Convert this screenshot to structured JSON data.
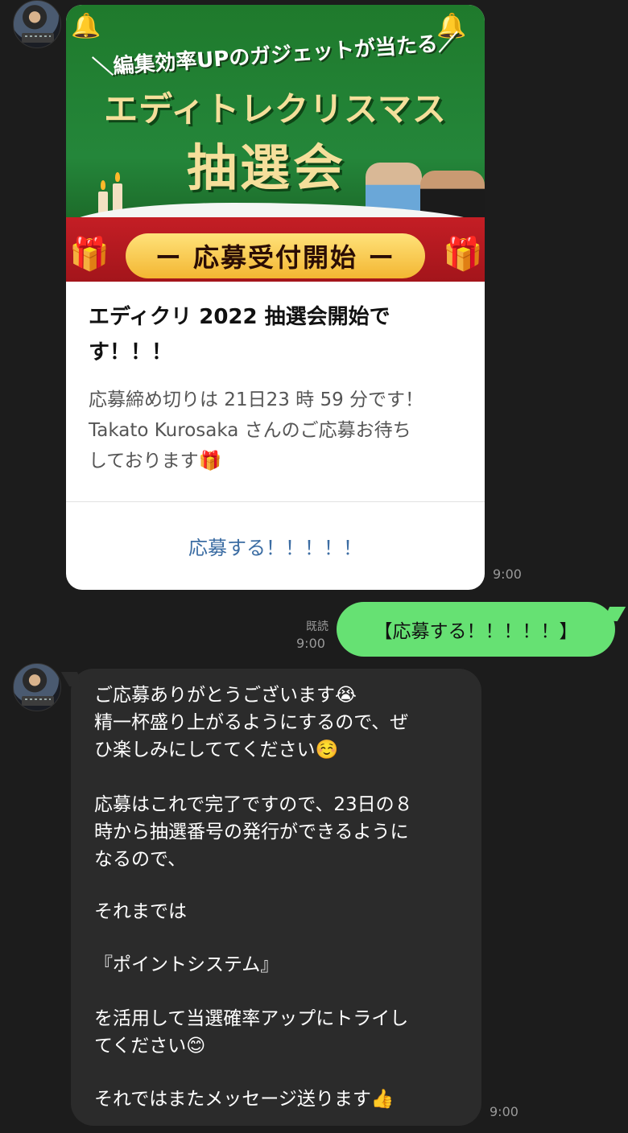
{
  "card": {
    "banner": {
      "headline1": "＼編集効率UPのガジェットが当たる／",
      "headline2": "エディトレクリスマス",
      "headline3": "抽選会",
      "band": "ー 応募受付開始 ー"
    },
    "title_line1": "エディクリ 2022 抽選会開始で",
    "title_line2": "す！！！",
    "desc_line1": "応募締め切りは 21日23 時 59 分です！",
    "desc_line2": "Takato Kurosaka さんのご応募お待ち",
    "desc_line3": "しております🎁",
    "action_label": "応募する！！！！！",
    "time": "9:00"
  },
  "outgoing": {
    "read_label": "既読",
    "time": "9:00",
    "text": "【応募する！！！！！】"
  },
  "reply": {
    "lines": [
      "ご応募ありがとうございます😭",
      "精一杯盛り上がるようにするので、ぜ",
      "ひ楽しみにしててください☺️",
      "応募はこれで完了ですので、23日の８",
      "時から抽選番号の発行ができるように",
      "なるので、",
      "それまでは",
      "『ポイントシステム』",
      "を活用して当選確率アップにトライし",
      "てください😊",
      "それではまたメッセージ送ります👍"
    ],
    "time": "9:00"
  },
  "colors": {
    "background": "#1c1c1c",
    "outgoing_bubble": "#66e173",
    "incoming_bubble": "#2b2b2b",
    "link": "#3c6da3"
  }
}
